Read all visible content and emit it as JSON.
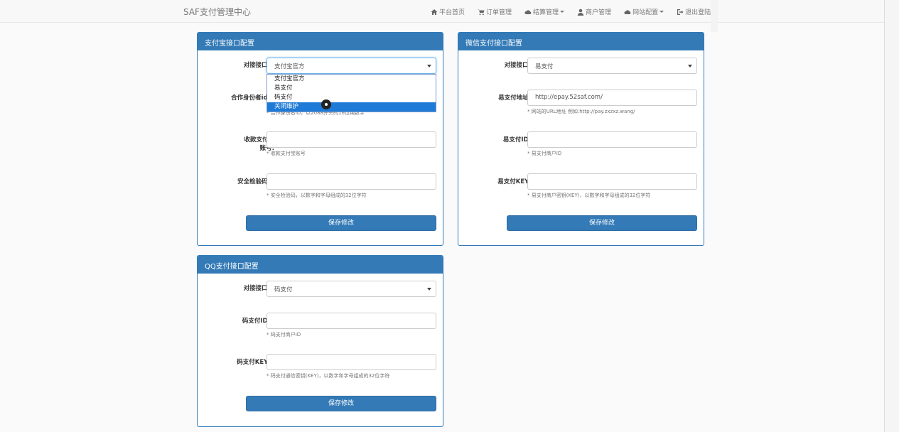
{
  "brand": "SAF支付管理中心",
  "nav": [
    {
      "label": "平台首页",
      "icon": "home-icon",
      "caret": false
    },
    {
      "label": "订单管理",
      "icon": "cart-icon",
      "caret": false
    },
    {
      "label": "结算管理",
      "icon": "cloud-icon",
      "caret": true
    },
    {
      "label": "商户管理",
      "icon": "user-icon",
      "caret": false
    },
    {
      "label": "网站配置",
      "icon": "cloud-icon",
      "caret": true
    },
    {
      "label": "退出登陆",
      "icon": "logout-icon",
      "caret": false
    }
  ],
  "alipay": {
    "title": "支付宝接口配置",
    "interface_label": "对接接口:",
    "interface_value": "支付宝官方",
    "options": [
      "支付宝官方",
      "易支付",
      "码支付",
      "关闭维护"
    ],
    "highlighted_option": "关闭维护",
    "partner_label": "合作身份者id:",
    "partner_value": "",
    "partner_help": "* 合作身份者ID，以2088开头的16位纯数字",
    "account_label": "收款支付宝账号:",
    "account_value": "",
    "account_help": "* 收款支付宝账号",
    "key_label": "安全检验码:",
    "key_value": "",
    "key_help": "* 安全检验码，以数字和字母组成的32位字符",
    "save_label": "保存修改"
  },
  "wechat": {
    "title": "微信支付接口配置",
    "interface_label": "对接接口:",
    "interface_value": "易支付",
    "url_label": "易支付地址:",
    "url_value": "http://epay.52saf.com/",
    "url_help": "* 网站的URL地址 例如:http://pay.zxzxz.wang/",
    "id_label": "易支付ID:",
    "id_value": "",
    "id_help": "* 易支付商户ID",
    "key_label": "易支付KEY:",
    "key_value": "",
    "key_help": "* 易支付商户密钥(KEY)，以数字和字母组成的32位字符",
    "save_label": "保存修改"
  },
  "qq": {
    "title": "QQ支付接口配置",
    "interface_label": "对接接口:",
    "interface_value": "码支付",
    "id_label": "码支付ID:",
    "id_value": "",
    "id_help": "* 码支付商户ID",
    "key_label": "码支付KEY:",
    "key_value": "",
    "key_help": "* 码支付通信密钥(KEY)，以数字和字母组成的32位字符",
    "save_label": "保存修改"
  }
}
